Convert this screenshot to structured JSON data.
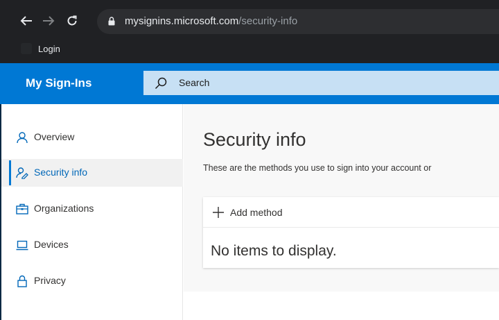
{
  "browser": {
    "url_host": "mysignins.microsoft.com",
    "url_path": "/security-info",
    "bookmark_label": "Login"
  },
  "header": {
    "app_title": "My Sign-Ins",
    "search_placeholder": "Search",
    "accent_color": "#0078d4"
  },
  "sidebar": {
    "items": [
      {
        "label": "Overview",
        "icon": "person-icon",
        "active": false
      },
      {
        "label": "Security info",
        "icon": "security-info-icon",
        "active": true
      },
      {
        "label": "Organizations",
        "icon": "briefcase-icon",
        "active": false
      },
      {
        "label": "Devices",
        "icon": "laptop-icon",
        "active": false
      },
      {
        "label": "Privacy",
        "icon": "lock-icon",
        "active": false
      }
    ]
  },
  "main": {
    "title": "Security info",
    "description": "These are the methods you use to sign into your account or",
    "add_method_label": "Add method",
    "empty_message": "No items to display."
  }
}
